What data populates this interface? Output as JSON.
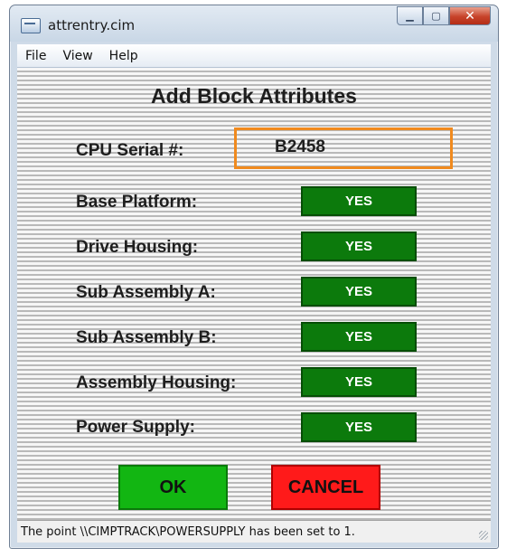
{
  "window": {
    "title": "attrentry.cim",
    "minimize_glyph": "▁",
    "maximize_glyph": "▢",
    "close_glyph": "✕"
  },
  "menu": {
    "items": [
      "File",
      "View",
      "Help"
    ]
  },
  "form": {
    "heading": "Add Block Attributes",
    "serial_label": "CPU Serial #:",
    "serial_value": "B2458",
    "rows": [
      {
        "label": "Base Platform:",
        "value": "YES"
      },
      {
        "label": "Drive Housing:",
        "value": "YES"
      },
      {
        "label": "Sub Assembly A:",
        "value": "YES"
      },
      {
        "label": "Sub Assembly B:",
        "value": "YES"
      },
      {
        "label": "Assembly Housing:",
        "value": "YES"
      },
      {
        "label": "Power Supply:",
        "value": "YES"
      }
    ],
    "ok_label": "OK",
    "cancel_label": "CANCEL"
  },
  "status": {
    "text": "The point \\\\CIMPTRACK\\POWERSUPPLY has been set to 1."
  },
  "colors": {
    "yes_button": "#0c7a0c",
    "ok_button": "#12b612",
    "cancel_button": "#ff1a1a",
    "serial_border": "#f08a1e"
  }
}
